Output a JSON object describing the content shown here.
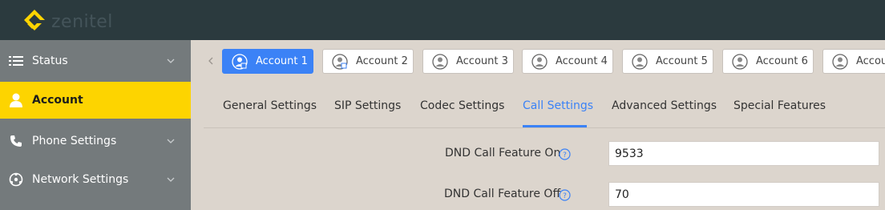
{
  "brand": {
    "name": "zenitel",
    "accent": "#fdd400",
    "topbar_bg": "#2b3a3e"
  },
  "sidebar": {
    "items": [
      {
        "label": "Status",
        "icon": "list-icon",
        "active": false,
        "has_chevron": true
      },
      {
        "label": "Account",
        "icon": "user-icon",
        "active": true,
        "has_chevron": false
      },
      {
        "label": "Phone Settings",
        "icon": "phone-icon",
        "active": false,
        "has_chevron": true
      },
      {
        "label": "Network Settings",
        "icon": "network-icon",
        "active": false,
        "has_chevron": true
      }
    ]
  },
  "accounts": {
    "items": [
      {
        "label": "Account 1",
        "active": true
      },
      {
        "label": "Account 2",
        "active": false
      },
      {
        "label": "Account 3",
        "active": false
      },
      {
        "label": "Account 4",
        "active": false
      },
      {
        "label": "Account 5",
        "active": false
      },
      {
        "label": "Account 6",
        "active": false
      },
      {
        "label": "Accou",
        "active": false
      }
    ]
  },
  "tabs": {
    "items": [
      {
        "label": "General Settings",
        "active": false
      },
      {
        "label": "SIP Settings",
        "active": false
      },
      {
        "label": "Codec Settings",
        "active": false
      },
      {
        "label": "Call Settings",
        "active": true
      },
      {
        "label": "Advanced Settings",
        "active": false
      },
      {
        "label": "Special Features",
        "active": false
      }
    ]
  },
  "fields": [
    {
      "label": "DND Call Feature On",
      "value": "9533"
    },
    {
      "label": "DND Call Feature Off",
      "value": "70"
    }
  ],
  "colors": {
    "primary": "#3b82f6",
    "sidebar_active": "#fdd400"
  }
}
